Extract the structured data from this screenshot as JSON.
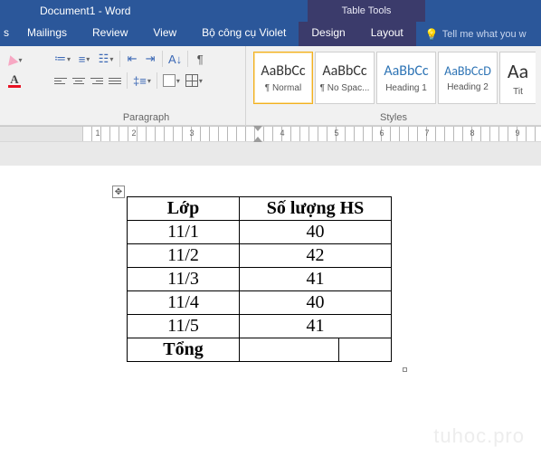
{
  "title": "Document1 - Word",
  "table_tools_label": "Table Tools",
  "tabs": {
    "first": "s",
    "mailings": "Mailings",
    "review": "Review",
    "view": "View",
    "violet": "Bộ công cụ Violet",
    "design": "Design",
    "layout": "Layout"
  },
  "tellme": "Tell me what you w",
  "groups": {
    "paragraph": "Paragraph",
    "styles": "Styles"
  },
  "font_color_letter": "A",
  "pilcrow": "¶",
  "styles": [
    {
      "sample": "AaBbCc",
      "name": "¶ Normal"
    },
    {
      "sample": "AaBbCc",
      "name": "¶ No Spac..."
    },
    {
      "sample": "AaBbCc",
      "name": "Heading 1"
    },
    {
      "sample": "AaBbCcD",
      "name": "Heading 2"
    },
    {
      "sample": "Aa",
      "name": "Tit"
    }
  ],
  "ruler_numbers": [
    "1",
    "2",
    "3",
    "4",
    "5",
    "6",
    "7",
    "8",
    "9"
  ],
  "table": {
    "headers": {
      "c1": "Lớp",
      "c2": "Số lượng HS"
    },
    "rows": [
      {
        "c1": "11/1",
        "c2": "40"
      },
      {
        "c1": "11/2",
        "c2": "42"
      },
      {
        "c1": "11/3",
        "c2": "41"
      },
      {
        "c1": "11/4",
        "c2": "40"
      },
      {
        "c1": "11/5",
        "c2": "41"
      }
    ],
    "footer": {
      "c1": "Tổng",
      "c2a": "",
      "c2b": ""
    }
  },
  "watermark": "tuhoc.pro"
}
